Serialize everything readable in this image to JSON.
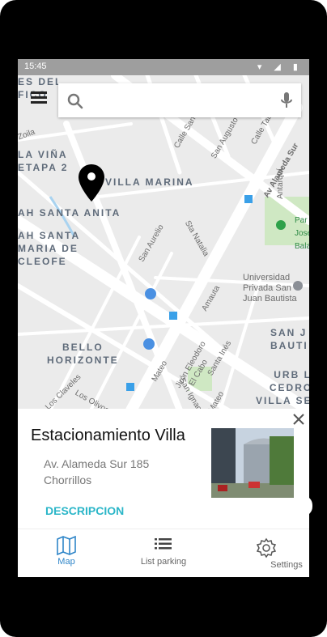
{
  "statusbar": {
    "time": "15:45"
  },
  "search": {
    "placeholder": ""
  },
  "map": {
    "labels": [
      "ES DEL\nFICO",
      "LA VIÑA\nETAPA 2",
      "VILLA MARINA",
      "AH SANTA ANITA",
      "AH SANTA\nMARIA DE\nCLEOFE",
      "BELLO\nHORIZONTE",
      "SAN J\nBAUTI",
      "URB LO\nCEDROS\nVILLA SEC\nETAPA",
      "Universidad\nPrivada San\nJuan Bautista",
      "Par\nJose\nBala",
      "Av Alameda Sur",
      "Calle San Felipe",
      "San Augusto",
      "Calle Tabuzza",
      "Sta Natalia",
      "San Aurelio",
      "Amauta",
      "Jirón Eleodoro",
      "El Cabo",
      "Santa Inés",
      "Los Claveles",
      "Los Olivos",
      "San Ignacio",
      "Mateo",
      "Mateo",
      "Antarquí",
      "Zoila"
    ]
  },
  "card": {
    "title": "Estacionamiento Villa",
    "address": "Av. Alameda Sur 185 Chorrillos",
    "link": "DESCRIPCION"
  },
  "nav": {
    "map": "Map",
    "list": "List parking",
    "settings": "Settings"
  },
  "colors": {
    "accent": "#2bb6c8",
    "nav_active": "#2e85c8"
  }
}
